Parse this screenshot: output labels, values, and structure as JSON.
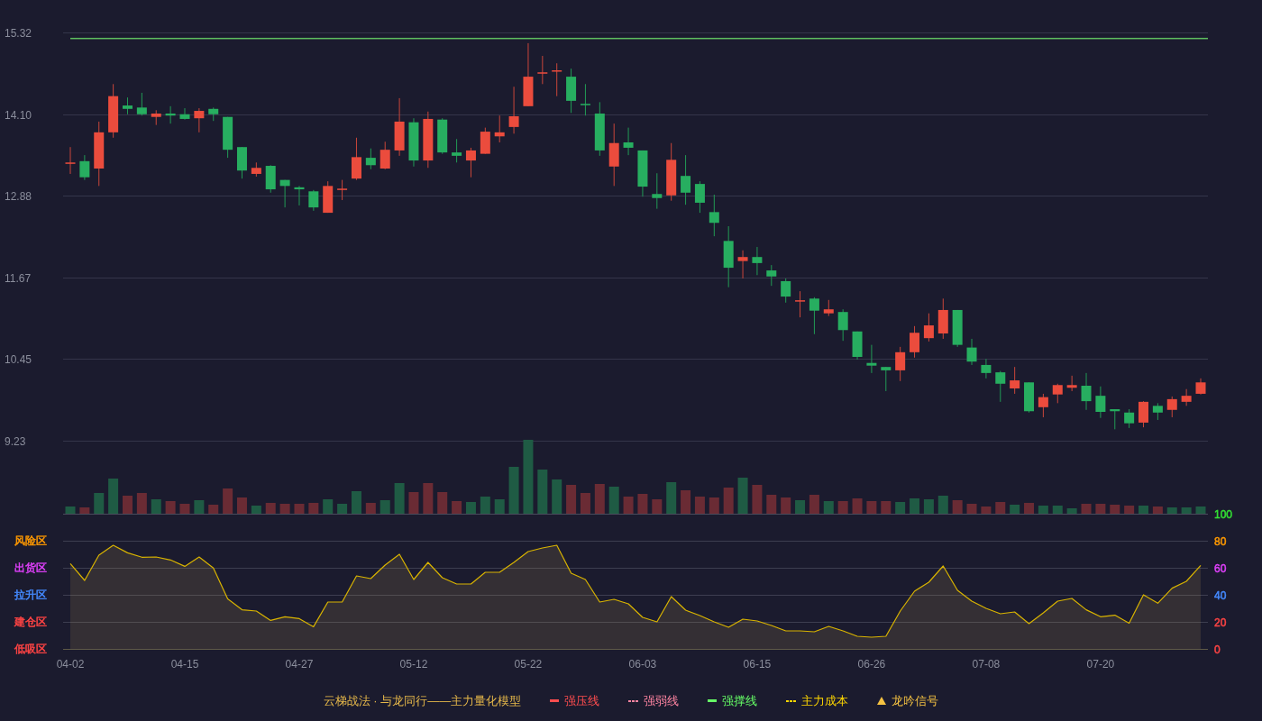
{
  "price_panel": {
    "chart_data": {
      "type": "candlestick",
      "grid": true,
      "ylim": [
        9.23,
        15.32
      ],
      "yticks": [
        {
          "value": 15.32,
          "label": "15.32"
        },
        {
          "value": 14.1,
          "label": "14.10"
        },
        {
          "value": 12.88,
          "label": "12.88"
        },
        {
          "value": 11.67,
          "label": "11.67"
        },
        {
          "value": 10.45,
          "label": "10.45"
        },
        {
          "value": 9.23,
          "label": "9.23"
        }
      ],
      "categories": [
        null,
        null,
        null,
        null,
        null,
        null,
        null,
        null,
        null,
        null,
        null,
        null,
        null,
        null,
        null,
        null,
        null,
        null,
        null,
        null,
        null,
        null,
        null,
        null,
        null,
        null,
        null,
        null,
        null,
        null,
        null,
        null,
        null,
        null,
        null,
        null,
        null,
        null,
        null,
        null,
        null,
        null,
        null,
        null,
        null,
        null,
        null,
        null,
        null,
        null,
        null,
        null,
        null,
        null,
        null,
        null,
        null,
        null,
        null,
        null,
        null,
        null,
        null,
        null,
        null,
        null,
        null,
        null,
        null,
        null,
        null,
        null,
        null,
        null,
        null,
        null,
        null,
        null,
        null,
        null
      ],
      "ohlc": [
        [
          13.36,
          13.61,
          13.21,
          13.38
        ],
        [
          13.4,
          13.49,
          13.12,
          13.16
        ],
        [
          13.29,
          13.99,
          13.03,
          13.83
        ],
        [
          13.83,
          14.55,
          13.75,
          14.37
        ],
        [
          14.23,
          14.35,
          14.1,
          14.18
        ],
        [
          14.2,
          14.42,
          14.08,
          14.1
        ],
        [
          14.06,
          14.16,
          13.94,
          14.11
        ],
        [
          14.11,
          14.22,
          13.96,
          14.08
        ],
        [
          14.1,
          14.19,
          14.02,
          14.03
        ],
        [
          14.04,
          14.19,
          13.83,
          14.15
        ],
        [
          14.18,
          14.2,
          14.0,
          14.1
        ],
        [
          14.06,
          14.06,
          13.45,
          13.57
        ],
        [
          13.61,
          13.61,
          13.14,
          13.26
        ],
        [
          13.21,
          13.38,
          13.17,
          13.3
        ],
        [
          13.33,
          13.34,
          12.93,
          12.98
        ],
        [
          13.12,
          13.12,
          12.71,
          13.03
        ],
        [
          13.01,
          13.03,
          12.74,
          12.98
        ],
        [
          12.95,
          12.97,
          12.66,
          12.71
        ],
        [
          12.63,
          13.1,
          12.63,
          13.03
        ],
        [
          12.97,
          13.12,
          12.82,
          12.99
        ],
        [
          13.14,
          13.75,
          13.12,
          13.46
        ],
        [
          13.45,
          13.59,
          13.28,
          13.34
        ],
        [
          13.29,
          13.69,
          13.28,
          13.57
        ],
        [
          13.56,
          14.34,
          13.48,
          13.99
        ],
        [
          13.98,
          14.04,
          13.32,
          13.41
        ],
        [
          13.41,
          14.14,
          13.3,
          14.03
        ],
        [
          14.02,
          14.04,
          13.51,
          13.53
        ],
        [
          13.53,
          13.73,
          13.38,
          13.48
        ],
        [
          13.41,
          13.6,
          13.16,
          13.56
        ],
        [
          13.51,
          13.9,
          13.51,
          13.84
        ],
        [
          13.77,
          14.08,
          13.68,
          13.83
        ],
        [
          13.91,
          14.51,
          13.81,
          14.07
        ],
        [
          14.22,
          15.16,
          14.22,
          14.66
        ],
        [
          14.71,
          14.97,
          14.55,
          14.72
        ],
        [
          14.74,
          14.86,
          14.37,
          14.75
        ],
        [
          14.66,
          14.78,
          14.12,
          14.3
        ],
        [
          14.25,
          14.55,
          14.08,
          14.24
        ],
        [
          14.11,
          14.28,
          13.48,
          13.56
        ],
        [
          13.32,
          13.96,
          13.03,
          13.67
        ],
        [
          13.68,
          13.9,
          13.49,
          13.6
        ],
        [
          13.56,
          13.56,
          12.87,
          13.02
        ],
        [
          12.91,
          13.22,
          12.69,
          12.85
        ],
        [
          12.89,
          13.67,
          12.81,
          13.42
        ],
        [
          13.18,
          13.49,
          12.75,
          12.93
        ],
        [
          13.06,
          13.1,
          12.63,
          12.78
        ],
        [
          12.64,
          12.9,
          12.28,
          12.48
        ],
        [
          12.21,
          12.43,
          11.52,
          11.81
        ],
        [
          11.91,
          12.07,
          11.65,
          11.97
        ],
        [
          11.97,
          12.12,
          11.7,
          11.88
        ],
        [
          11.77,
          11.85,
          11.54,
          11.68
        ],
        [
          11.61,
          11.65,
          11.29,
          11.38
        ],
        [
          11.31,
          11.46,
          11.07,
          11.32
        ],
        [
          11.35,
          11.37,
          10.82,
          11.17
        ],
        [
          11.13,
          11.33,
          11.09,
          11.19
        ],
        [
          11.15,
          11.19,
          10.72,
          10.88
        ],
        [
          10.86,
          10.86,
          10.44,
          10.48
        ],
        [
          10.39,
          10.66,
          10.24,
          10.35
        ],
        [
          10.33,
          10.33,
          9.97,
          10.28
        ],
        [
          10.28,
          10.63,
          10.12,
          10.55
        ],
        [
          10.55,
          10.94,
          10.47,
          10.84
        ],
        [
          10.76,
          11.13,
          10.71,
          10.95
        ],
        [
          10.83,
          11.35,
          10.75,
          11.18
        ],
        [
          11.18,
          11.18,
          10.63,
          10.66
        ],
        [
          10.62,
          10.75,
          10.36,
          10.41
        ],
        [
          10.36,
          10.45,
          10.16,
          10.24
        ],
        [
          10.25,
          10.27,
          9.81,
          10.08
        ],
        [
          10.01,
          10.33,
          9.93,
          10.13
        ],
        [
          10.1,
          10.1,
          9.65,
          9.67
        ],
        [
          9.73,
          9.93,
          9.58,
          9.88
        ],
        [
          9.92,
          10.08,
          9.79,
          10.06
        ],
        [
          10.02,
          10.2,
          9.97,
          10.06
        ],
        [
          10.05,
          10.24,
          9.69,
          9.82
        ],
        [
          9.9,
          10.04,
          9.57,
          9.66
        ],
        [
          9.7,
          9.7,
          9.4,
          9.67
        ],
        [
          9.65,
          9.7,
          9.42,
          9.49
        ],
        [
          9.5,
          9.82,
          9.43,
          9.81
        ],
        [
          9.75,
          9.79,
          9.54,
          9.65
        ],
        [
          9.69,
          9.89,
          9.58,
          9.85
        ],
        [
          9.81,
          10.0,
          9.75,
          9.9
        ],
        [
          9.93,
          10.16,
          9.92,
          10.1
        ]
      ],
      "ref_lines": [
        {
          "axis": "y",
          "value": 15.23
        }
      ]
    }
  },
  "indicator_panel": {
    "zone_labels": [
      {
        "label": "风险区",
        "color": "#ff9900"
      },
      {
        "label": "出货区",
        "color": "#e040fb"
      },
      {
        "label": "拉升区",
        "color": "#448aff"
      },
      {
        "label": "建仓区",
        "color": "#ff4444"
      },
      {
        "label": "低吸区",
        "color": "#ff4444"
      }
    ],
    "right_axis_labels": [
      {
        "label": "100",
        "color": "#33e033"
      },
      {
        "label": "80",
        "color": "#ff9900"
      },
      {
        "label": "60",
        "color": "#e040fb"
      },
      {
        "label": "40",
        "color": "#448aff"
      },
      {
        "label": "20",
        "color": "#ff4444"
      },
      {
        "label": "0",
        "color": "#ff4444"
      }
    ],
    "chart_data": {
      "type": "area",
      "grid": true,
      "ylim": [
        0,
        100
      ],
      "yticks": [
        100,
        80,
        60,
        40,
        20,
        0
      ],
      "categories": [
        "04-02",
        null,
        null,
        null,
        null,
        null,
        null,
        null,
        "04-15",
        null,
        null,
        null,
        null,
        null,
        null,
        null,
        "04-27",
        null,
        null,
        null,
        null,
        null,
        null,
        null,
        "05-12",
        null,
        null,
        null,
        null,
        null,
        null,
        null,
        "05-22",
        null,
        null,
        null,
        null,
        null,
        null,
        null,
        "06-03",
        null,
        null,
        null,
        null,
        null,
        null,
        null,
        "06-15",
        null,
        null,
        null,
        null,
        null,
        null,
        null,
        "06-26",
        null,
        null,
        null,
        null,
        null,
        null,
        null,
        "07-08",
        null,
        null,
        null,
        null,
        null,
        null,
        null,
        "07-20",
        null,
        null,
        null,
        null,
        null,
        null,
        null
      ],
      "values": [
        63.1,
        50.7,
        69.3,
        76.7,
        71.1,
        67.8,
        68.0,
        65.8,
        61.1,
        68.0,
        59.8,
        37.1,
        28.9,
        28.0,
        21.1,
        23.8,
        22.4,
        16.4,
        34.7,
        34.7,
        54.0,
        52.0,
        62.0,
        70.0,
        51.3,
        64.0,
        52.7,
        48.0,
        48.0,
        56.7,
        56.7,
        64.0,
        72.0,
        74.7,
        76.7,
        56.0,
        51.3,
        34.7,
        36.7,
        33.3,
        23.3,
        20.0,
        38.7,
        28.7,
        24.7,
        20.0,
        16.0,
        22.0,
        20.7,
        17.3,
        13.3,
        13.3,
        12.7,
        16.7,
        13.3,
        9.3,
        8.7,
        9.3,
        28.0,
        42.7,
        49.3,
        61.3,
        43.3,
        35.3,
        30.0,
        26.0,
        27.3,
        18.7,
        26.7,
        35.3,
        37.3,
        28.9,
        23.8,
        24.9,
        19.1,
        40.0,
        33.8,
        44.9,
        50.0,
        61.8
      ]
    }
  },
  "legend": {
    "title": "云梯战法 · 与龙同行——主力量化模型",
    "items": [
      {
        "kind": "line",
        "label": "强压线",
        "color": "#ff4d4f"
      },
      {
        "kind": "dashed",
        "label": "强弱线",
        "color": "#ff85a2"
      },
      {
        "kind": "line",
        "label": "强撑线",
        "color": "#66ff66"
      },
      {
        "kind": "dashed",
        "label": "主力成本",
        "color": "#ffd700"
      },
      {
        "kind": "triangle",
        "label": "龙吟信号",
        "color": "#f5c242"
      }
    ]
  }
}
